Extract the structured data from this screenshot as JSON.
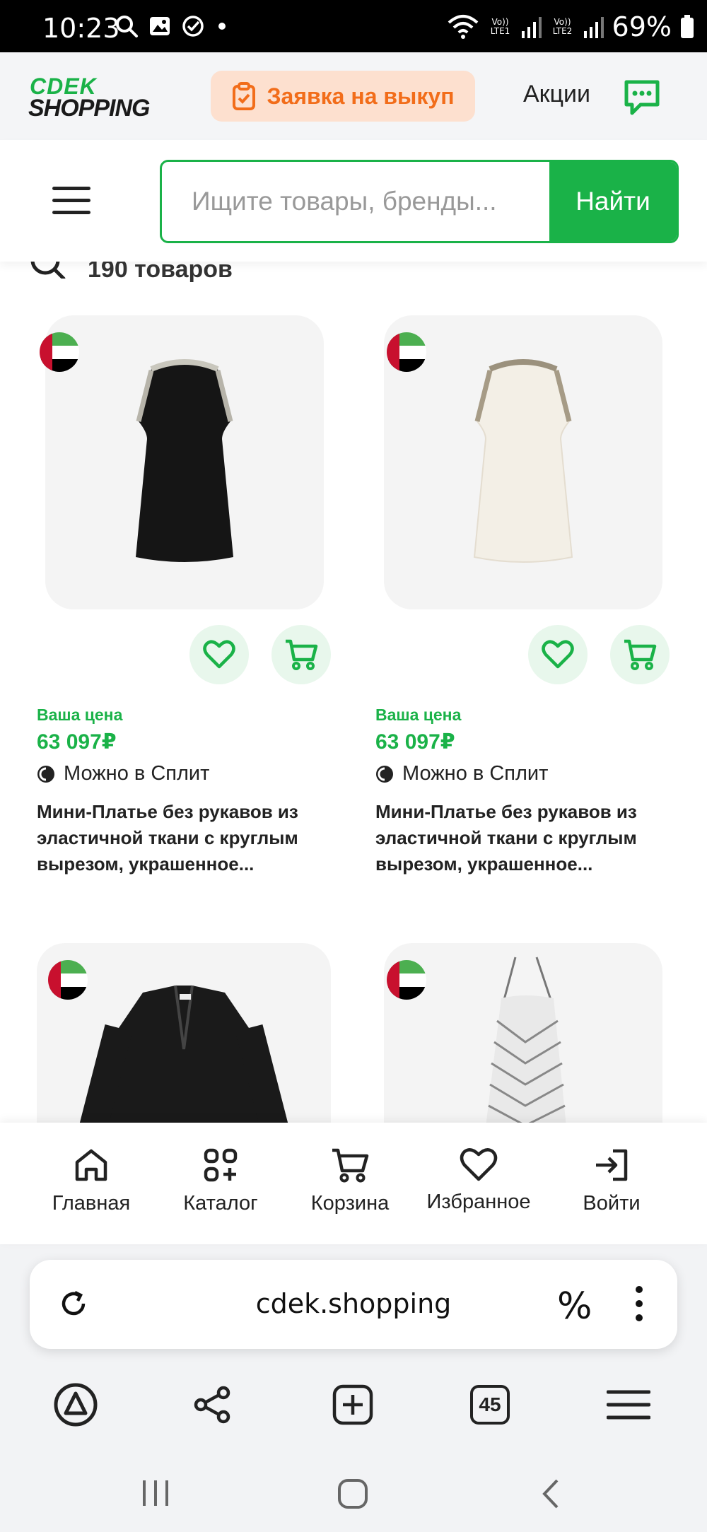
{
  "status_bar": {
    "time": "10:23",
    "lte1": "Vo)) LTE1",
    "lte2": "Vo)) LTE2",
    "battery": "69%"
  },
  "header": {
    "logo_top": "CDEK",
    "logo_bottom": "SHOPPING",
    "buyout_label": "Заявка на выкуп",
    "promo_label": "Акции"
  },
  "search": {
    "placeholder": "Ищите товары, бренды...",
    "button_label": "Найти"
  },
  "results": {
    "count_text": "190 товаров"
  },
  "products": [
    {
      "price_caption": "Ваша цена",
      "price": "63 097₽",
      "split_label": "Можно в Сплит",
      "title": "Мини-Платье без рукавов из эластичной ткани с круглым вырезом, украшенное...",
      "color": "#151515"
    },
    {
      "price_caption": "Ваша цена",
      "price": "63 097₽",
      "split_label": "Можно в Сплит",
      "title": "Мини-Платье без рукавов из эластичной ткани с круглым вырезом, украшенное...",
      "color": "#f3efe6"
    },
    {
      "color": "#1a1a1a"
    },
    {
      "color": "#e9e9e9"
    }
  ],
  "bottom_nav": [
    {
      "label": "Главная",
      "icon": "home-icon"
    },
    {
      "label": "Каталог",
      "icon": "catalog-icon"
    },
    {
      "label": "Корзина",
      "icon": "cart-icon"
    },
    {
      "label": "Избранное",
      "icon": "heart-icon"
    },
    {
      "label": "Войти",
      "icon": "login-icon"
    }
  ],
  "browser": {
    "url": "cdek.shopping",
    "discount_symbol": "%",
    "tabs_count": "45"
  },
  "colors": {
    "brand_green": "#1ab248",
    "buyout_orange": "#f26d1a",
    "buyout_bg": "#fde0cf"
  }
}
